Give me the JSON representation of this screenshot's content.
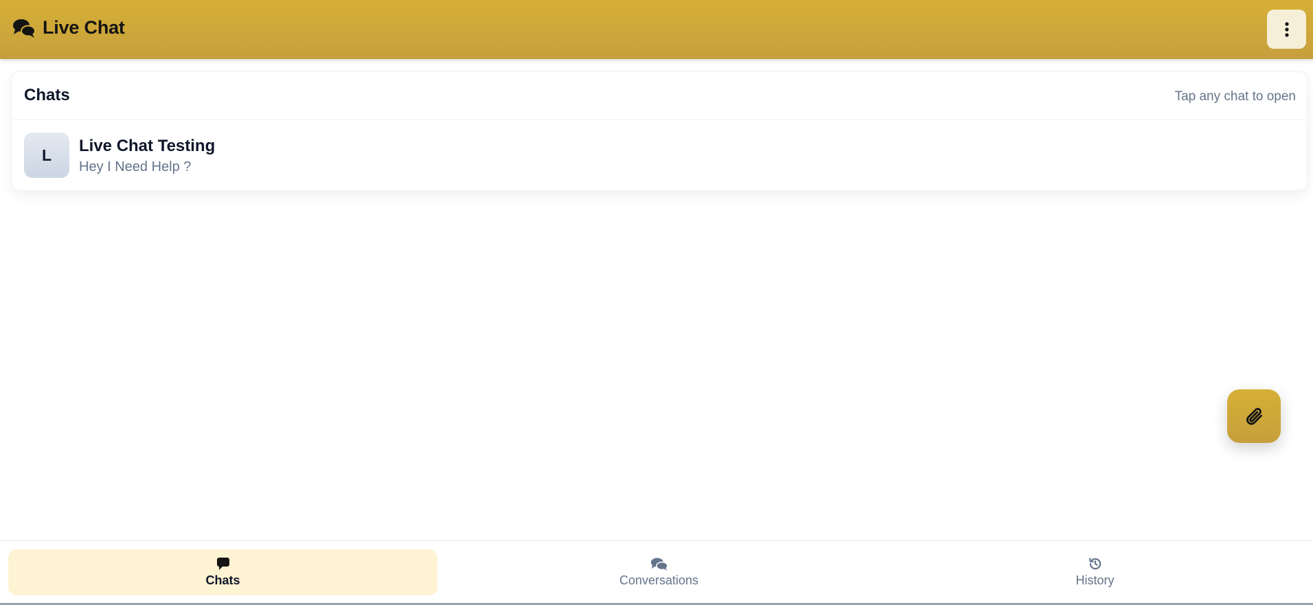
{
  "header": {
    "title": "Live Chat",
    "brand_icon": "chat-bubbles-icon",
    "menu_icon": "vertical-dots-icon"
  },
  "chats_panel": {
    "title": "Chats",
    "hint": "Tap any chat to open",
    "items": [
      {
        "avatar_letter": "L",
        "name": "Live Chat Testing",
        "preview": "Hey I Need Help ?"
      }
    ]
  },
  "fab": {
    "icon": "paperclip-icon"
  },
  "bottom_nav": {
    "items": [
      {
        "label": "Chats",
        "icon": "chat-bubble-icon",
        "active": true
      },
      {
        "label": "Conversations",
        "icon": "chat-bubbles-icon",
        "active": false
      },
      {
        "label": "History",
        "icon": "history-icon",
        "active": false
      }
    ]
  },
  "colors": {
    "header_gold": "#d6b035",
    "active_tab_bg": "#fef3d3",
    "muted_text": "#64748b",
    "primary_text": "#0f172a"
  }
}
